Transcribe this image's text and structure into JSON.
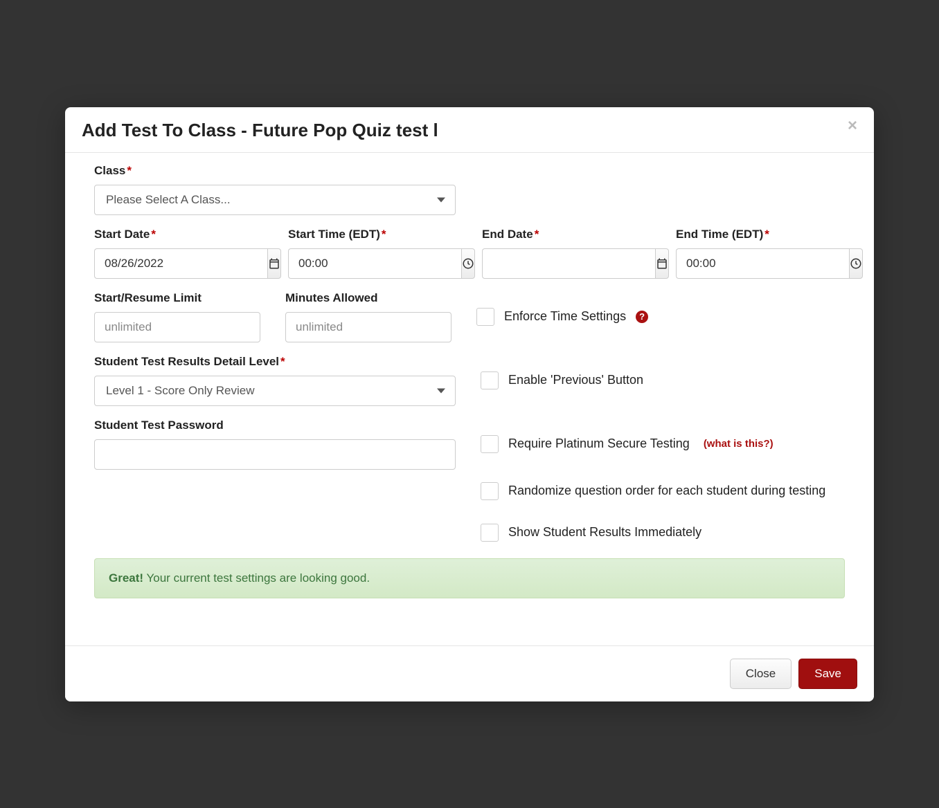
{
  "modal": {
    "title": "Add Test To Class - Future Pop Quiz test l",
    "closeLabel": "×"
  },
  "fields": {
    "class": {
      "label": "Class",
      "placeholder": "Please Select A Class..."
    },
    "startDate": {
      "label": "Start Date",
      "value": "08/26/2022"
    },
    "startTime": {
      "label": "Start Time (EDT)",
      "value": "00:00"
    },
    "endDate": {
      "label": "End Date",
      "value": ""
    },
    "endTime": {
      "label": "End Time (EDT)",
      "value": "00:00"
    },
    "startResumeLimit": {
      "label": "Start/Resume Limit",
      "placeholder": "unlimited"
    },
    "minutesAllowed": {
      "label": "Minutes Allowed",
      "placeholder": "unlimited"
    },
    "detailLevel": {
      "label": "Student Test Results Detail Level",
      "value": "Level 1 - Score Only Review"
    },
    "password": {
      "label": "Student Test Password",
      "value": ""
    }
  },
  "checks": {
    "enforceTime": "Enforce Time Settings",
    "enablePrevious": "Enable 'Previous' Button",
    "requireSecure": "Require Platinum Secure Testing",
    "whatIsThis": "(what is this?)",
    "randomize": "Randomize question order for each student during testing",
    "showResults": "Show Student Results Immediately"
  },
  "alert": {
    "strong": "Great!",
    "text": " Your current test settings are looking good."
  },
  "footer": {
    "close": "Close",
    "save": "Save"
  }
}
